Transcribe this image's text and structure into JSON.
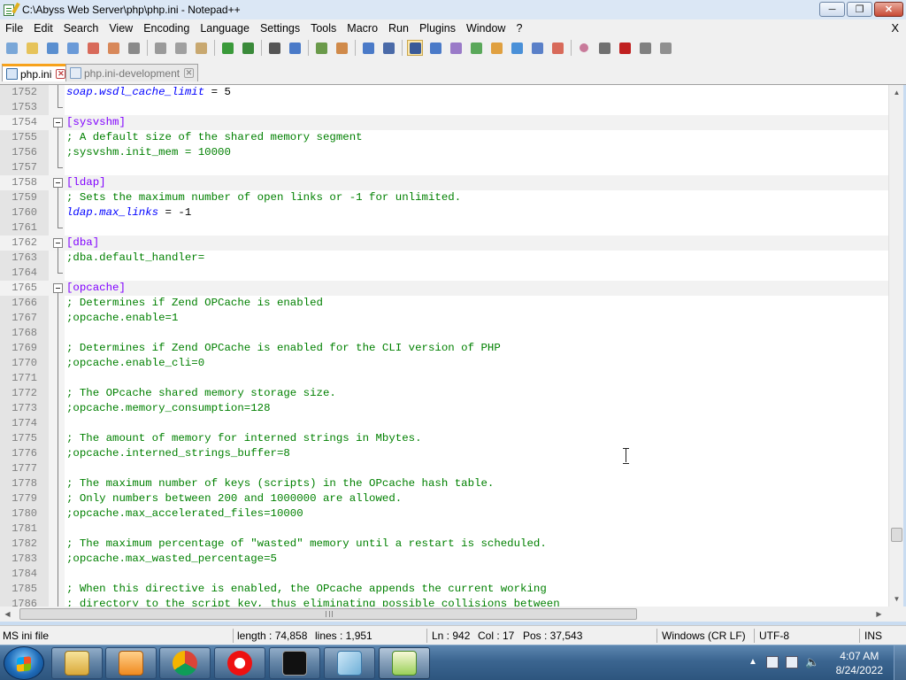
{
  "window": {
    "title": "C:\\Abyss Web Server\\php\\php.ini - Notepad++"
  },
  "menu": [
    "File",
    "Edit",
    "Search",
    "View",
    "Encoding",
    "Language",
    "Settings",
    "Tools",
    "Macro",
    "Run",
    "Plugins",
    "Window",
    "?"
  ],
  "menu_close": "X",
  "toolbar": {
    "icons": [
      "new-file-icon",
      "open-file-icon",
      "save-icon",
      "save-all-icon",
      "close-icon",
      "close-all-icon",
      "print-icon",
      "sep",
      "cut-icon",
      "copy-icon",
      "paste-icon",
      "sep",
      "undo-icon",
      "redo-icon",
      "sep",
      "find-icon",
      "replace-icon",
      "sep",
      "zoom-in-icon",
      "zoom-out-icon",
      "sep",
      "sync-vertical-icon",
      "sync-horizontal-icon",
      "sep",
      "word-wrap-icon",
      "show-all-chars-icon",
      "indent-guide-icon",
      "udl-icon",
      "doc-map-icon",
      "function-list-icon",
      "folder-workspace-icon",
      "monitoring-icon",
      "sep",
      "record-macro-icon",
      "stop-macro-icon",
      "play-macro-icon",
      "run-macro-multiple-icon",
      "save-macro-icon"
    ]
  },
  "tabs": [
    {
      "label": "php.ini",
      "active": true
    },
    {
      "label": "php.ini-development",
      "active": false
    }
  ],
  "editor": {
    "lines": [
      {
        "n": "1752",
        "parts": [
          [
            "key",
            "soap.wsdl_cache_limit"
          ],
          [
            "op",
            " = "
          ],
          [
            "val",
            "5"
          ]
        ]
      },
      {
        "n": "1753",
        "parts": []
      },
      {
        "n": "1754",
        "parts": [
          [
            "section",
            "[sysvshm]"
          ]
        ],
        "fold": true
      },
      {
        "n": "1755",
        "parts": [
          [
            "comment",
            "; A default size of the shared memory segment"
          ]
        ]
      },
      {
        "n": "1756",
        "parts": [
          [
            "comment",
            ";sysvshm.init_mem = 10000"
          ]
        ]
      },
      {
        "n": "1757",
        "parts": []
      },
      {
        "n": "1758",
        "parts": [
          [
            "section",
            "[ldap]"
          ]
        ],
        "fold": true
      },
      {
        "n": "1759",
        "parts": [
          [
            "comment",
            "; Sets the maximum number of open links or -1 for unlimited."
          ]
        ]
      },
      {
        "n": "1760",
        "parts": [
          [
            "key",
            "ldap.max_links"
          ],
          [
            "op",
            " = "
          ],
          [
            "val",
            "-1"
          ]
        ]
      },
      {
        "n": "1761",
        "parts": []
      },
      {
        "n": "1762",
        "parts": [
          [
            "section",
            "[dba]"
          ]
        ],
        "fold": true
      },
      {
        "n": "1763",
        "parts": [
          [
            "comment",
            ";dba.default_handler="
          ]
        ]
      },
      {
        "n": "1764",
        "parts": []
      },
      {
        "n": "1765",
        "parts": [
          [
            "section",
            "[opcache]"
          ]
        ],
        "fold": true
      },
      {
        "n": "1766",
        "parts": [
          [
            "comment",
            "; Determines if Zend OPCache is enabled"
          ]
        ]
      },
      {
        "n": "1767",
        "parts": [
          [
            "comment",
            ";opcache.enable=1"
          ]
        ]
      },
      {
        "n": "1768",
        "parts": []
      },
      {
        "n": "1769",
        "parts": [
          [
            "comment",
            "; Determines if Zend OPCache is enabled for the CLI version of PHP"
          ]
        ]
      },
      {
        "n": "1770",
        "parts": [
          [
            "comment",
            ";opcache.enable_cli=0"
          ]
        ]
      },
      {
        "n": "1771",
        "parts": []
      },
      {
        "n": "1772",
        "parts": [
          [
            "comment",
            "; The OPcache shared memory storage size."
          ]
        ]
      },
      {
        "n": "1773",
        "parts": [
          [
            "comment",
            ";opcache.memory_consumption=128"
          ]
        ]
      },
      {
        "n": "1774",
        "parts": []
      },
      {
        "n": "1775",
        "parts": [
          [
            "comment",
            "; The amount of memory for interned strings in Mbytes."
          ]
        ]
      },
      {
        "n": "1776",
        "parts": [
          [
            "comment",
            ";opcache.interned_strings_buffer=8"
          ]
        ]
      },
      {
        "n": "1777",
        "parts": []
      },
      {
        "n": "1778",
        "parts": [
          [
            "comment",
            "; The maximum number of keys (scripts) in the OPcache hash table."
          ]
        ]
      },
      {
        "n": "1779",
        "parts": [
          [
            "comment",
            "; Only numbers between 200 and 1000000 are allowed."
          ]
        ]
      },
      {
        "n": "1780",
        "parts": [
          [
            "comment",
            ";opcache.max_accelerated_files=10000"
          ]
        ]
      },
      {
        "n": "1781",
        "parts": []
      },
      {
        "n": "1782",
        "parts": [
          [
            "comment",
            "; The maximum percentage of \"wasted\" memory until a restart is scheduled."
          ]
        ]
      },
      {
        "n": "1783",
        "parts": [
          [
            "comment",
            ";opcache.max_wasted_percentage=5"
          ]
        ]
      },
      {
        "n": "1784",
        "parts": []
      },
      {
        "n": "1785",
        "parts": [
          [
            "comment",
            "; When this directive is enabled, the OPcache appends the current working"
          ]
        ]
      },
      {
        "n": "1786",
        "parts": [
          [
            "comment",
            "; directory to the script key, thus eliminating possible collisions between"
          ]
        ]
      }
    ]
  },
  "status": {
    "filetype": "MS ini file",
    "length": "length : 74,858",
    "lines": "lines : 1,951",
    "ln": "Ln : 942",
    "col": "Col : 17",
    "pos": "Pos : 37,543",
    "eol": "Windows (CR LF)",
    "encoding": "UTF-8",
    "mode": "INS"
  },
  "taskbar": {
    "apps": [
      "file-explorer-icon",
      "media-player-icon",
      "chrome-icon",
      "youtube-music-icon",
      "command-prompt-icon",
      "notepad-icon",
      "notepad-plus-plus-icon"
    ],
    "time": "4:07 AM",
    "date": "8/24/2022"
  },
  "colors": {
    "comment": "#008000",
    "section": "#8000ff",
    "key": "#0000ff",
    "active_tab_accent": "#f7a21b"
  }
}
